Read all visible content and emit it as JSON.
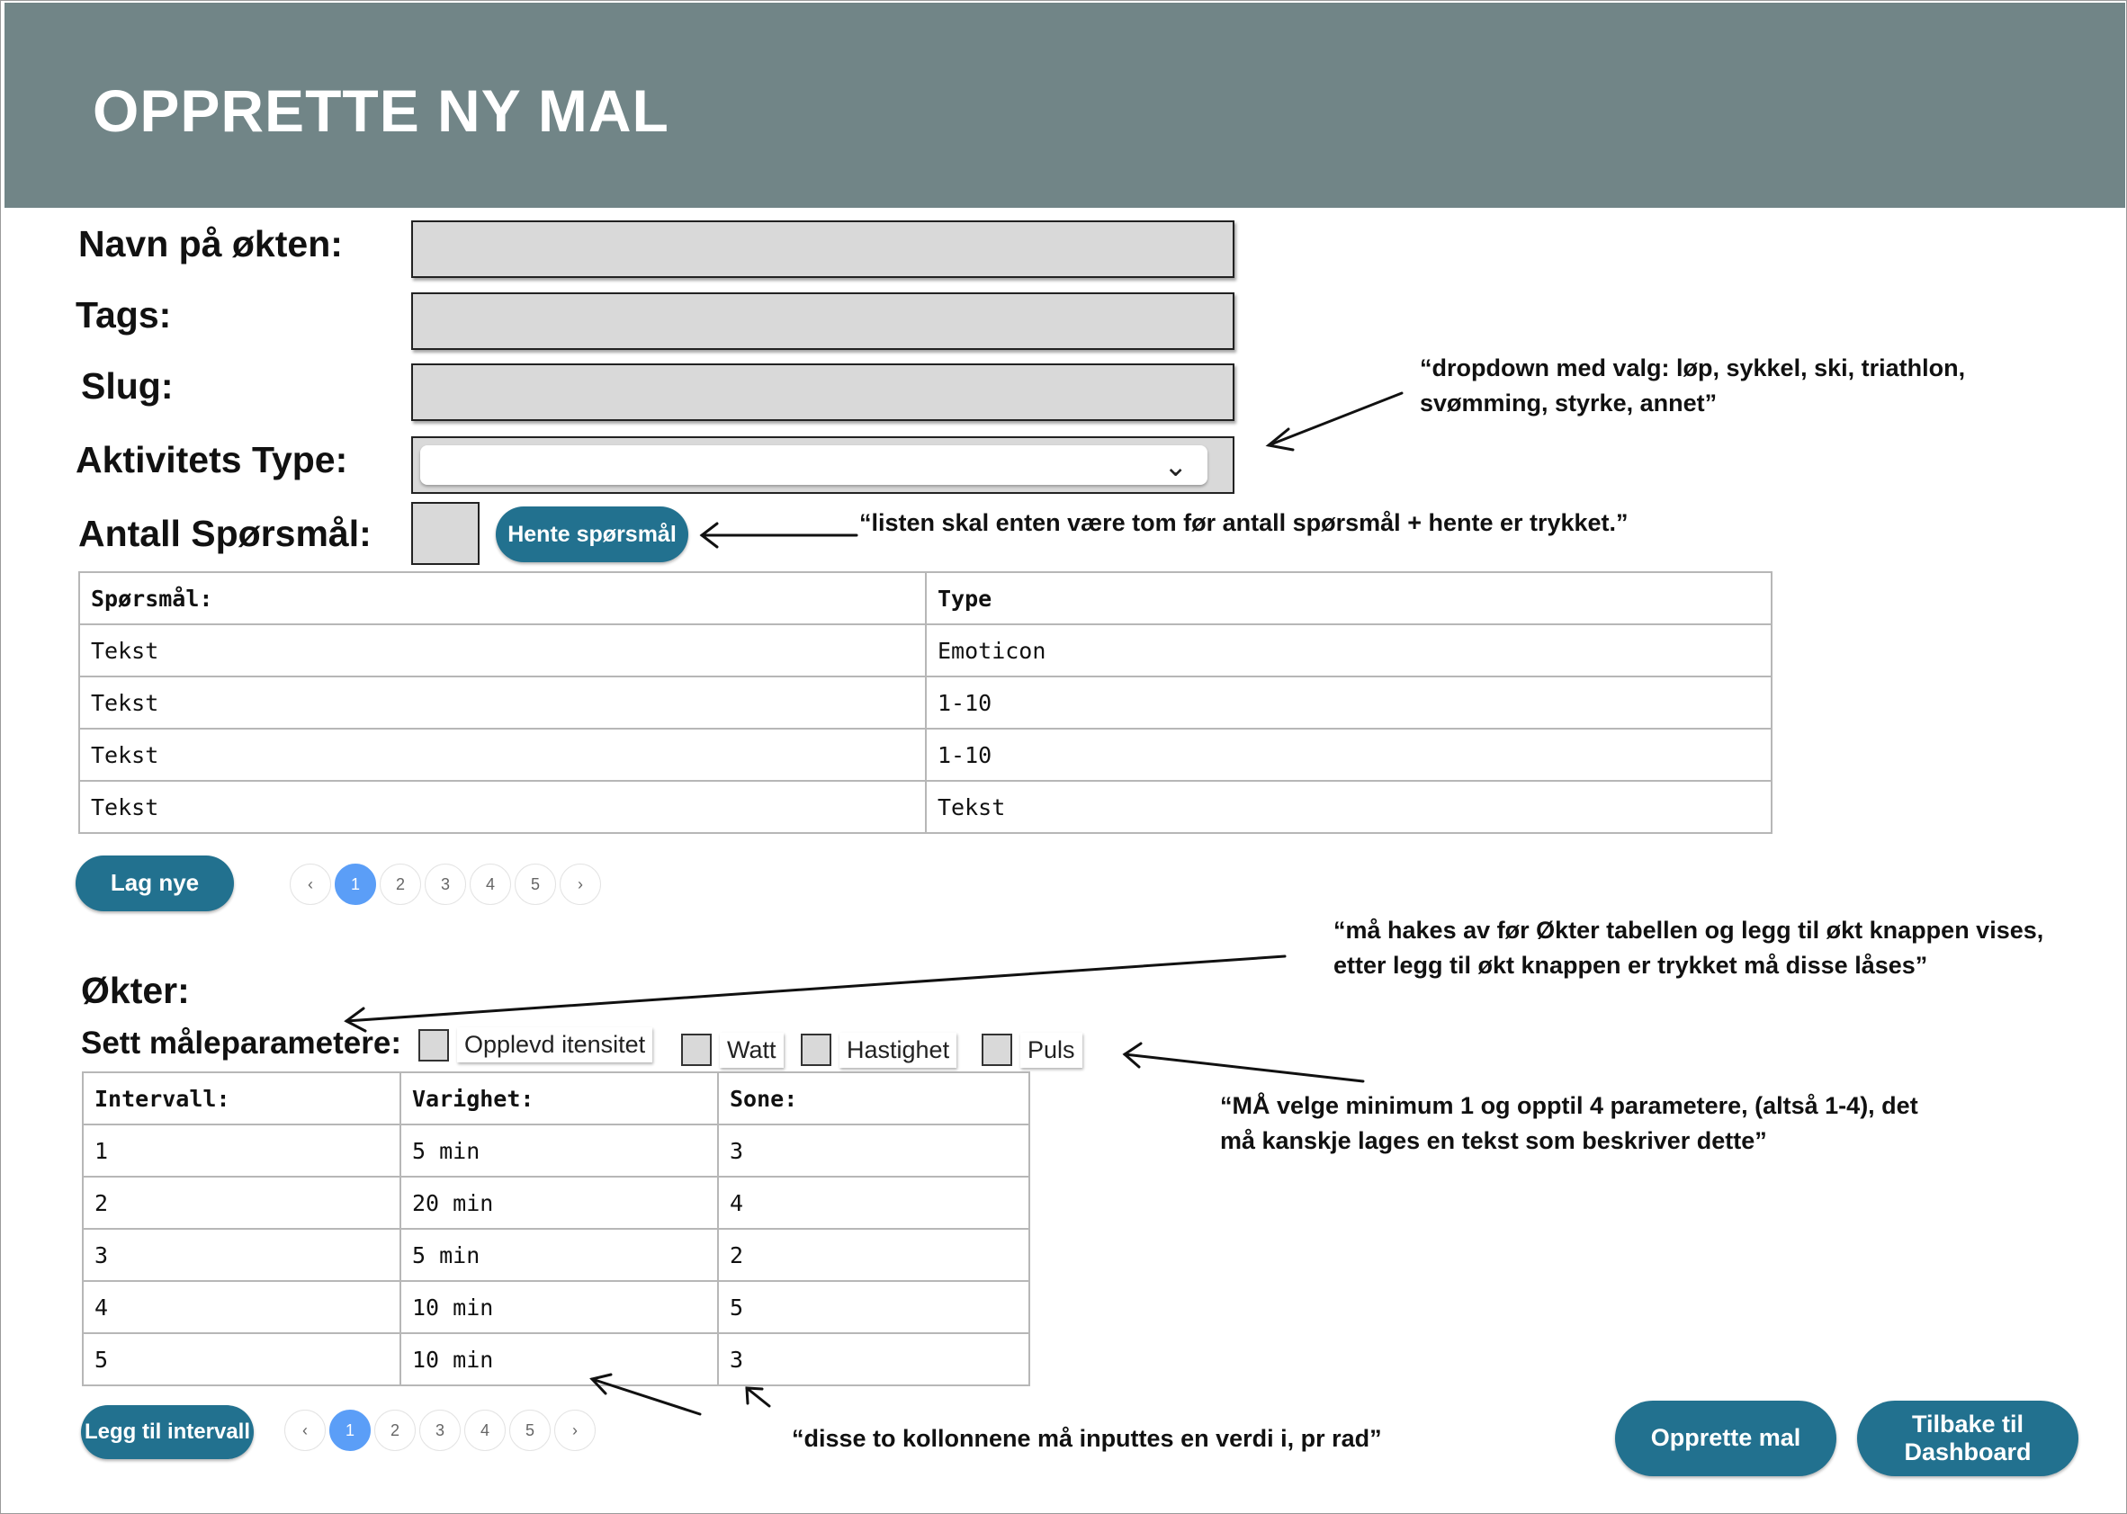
{
  "header": {
    "title": "OPPRETTE NY MAL"
  },
  "form": {
    "name_label": "Navn på økten:",
    "tags_label": "Tags:",
    "slug_label": "Slug:",
    "activity_label": "Aktivitets Type:",
    "count_label": "Antall Spørsmål:",
    "name_value": "",
    "tags_value": "",
    "slug_value": "",
    "count_value": "",
    "fetch_button": "Hente spørsmål"
  },
  "questions": {
    "headers": [
      "Spørsmål:",
      "Type"
    ],
    "rows": [
      [
        "Tekst",
        "Emoticon"
      ],
      [
        "Tekst",
        "1-10"
      ],
      [
        "Tekst",
        "1-10"
      ],
      [
        "Tekst",
        "Tekst"
      ]
    ],
    "new_button": "Lag nye",
    "pager": [
      "‹",
      "1",
      "2",
      "3",
      "4",
      "5",
      "›"
    ]
  },
  "sessions": {
    "title": "Økter:",
    "params_label": "Sett måleparametere:",
    "params": [
      "Opplevd itensitet",
      "Watt",
      "Hastighet",
      "Puls"
    ],
    "headers": [
      "Intervall:",
      "Varighet:",
      "Sone:"
    ],
    "rows": [
      [
        "1",
        "5 min",
        "3"
      ],
      [
        "2",
        "20 min",
        "4"
      ],
      [
        "3",
        "5 min",
        "2"
      ],
      [
        "4",
        "10 min",
        "5"
      ],
      [
        "5",
        "10 min",
        "3"
      ]
    ],
    "add_button": "Legg til intervall",
    "pager": [
      "‹",
      "1",
      "2",
      "3",
      "4",
      "5",
      "›"
    ]
  },
  "actions": {
    "create_button": "Opprette mal",
    "back_button": "Tilbake til Dashboard"
  },
  "annotations": {
    "dropdown": "“dropdown med valg: løp, sykkel, ski, triathlon, svømming, styrke, annet”",
    "list": "“listen skal enten være tom før antall spørsmål + hente er trykket.”",
    "params": "“må hakes av før Økter tabellen og legg til økt knappen vises, etter legg til økt knappen er trykket må disse låses”",
    "minimum": "“MÅ velge minimum 1 og opptil 4 parametere, (altså 1-4), det må kanskje lages en tekst som beskriver dette”",
    "columns": "“disse to kollonnene må inputtes en verdi i, pr rad”"
  }
}
